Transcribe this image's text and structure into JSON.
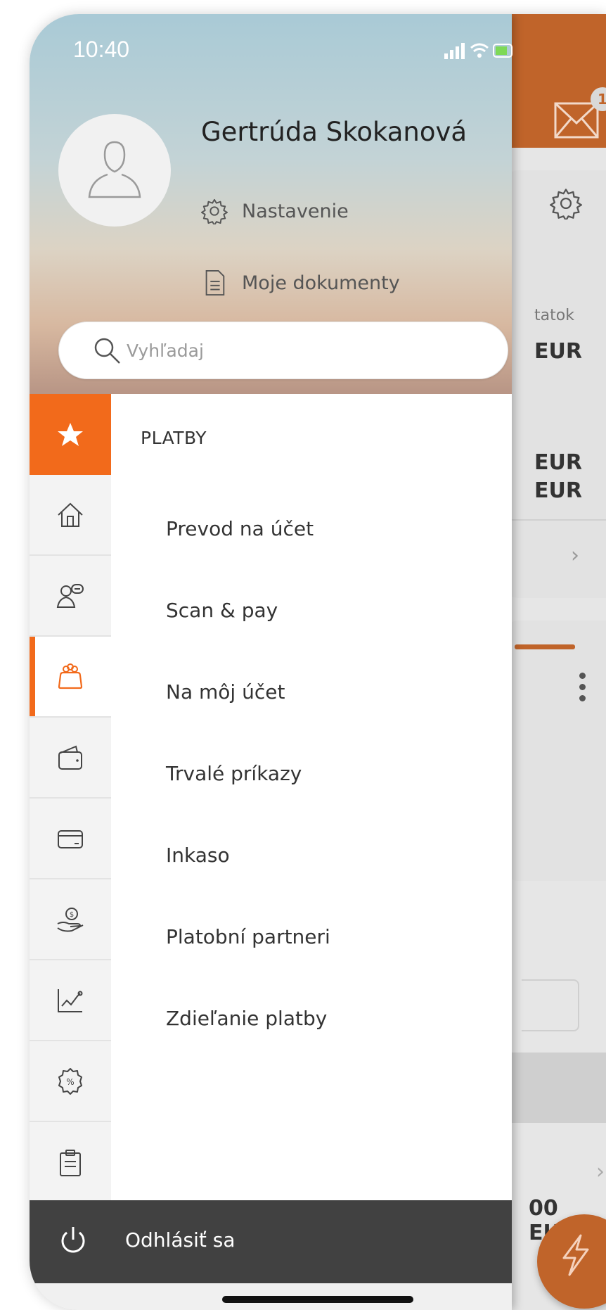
{
  "status_bar": {
    "time": "10:40"
  },
  "user": {
    "name": "Gertrúda Skokanová"
  },
  "header_links": {
    "settings": "Nastavenie",
    "documents": "Moje dokumenty"
  },
  "search": {
    "placeholder": "Vyhľadaj"
  },
  "rail": {
    "items": [
      {
        "icon": "star-icon",
        "state": "favorites"
      },
      {
        "icon": "home-icon"
      },
      {
        "icon": "user-chat-icon"
      },
      {
        "icon": "payments-purse-icon",
        "state": "active"
      },
      {
        "icon": "wallet-icon"
      },
      {
        "icon": "card-icon"
      },
      {
        "icon": "hand-coin-icon"
      },
      {
        "icon": "chart-line-icon"
      },
      {
        "icon": "percent-badge-icon"
      },
      {
        "icon": "clipboard-icon"
      }
    ]
  },
  "menu": {
    "section_title": "PLATBY",
    "items": [
      "Prevod na účet",
      "Scan & pay",
      "Na môj účet",
      "Trvalé príkazy",
      "Inkaso",
      "Platobní partneri",
      "Zdieľanie platby"
    ]
  },
  "logout": {
    "label": "Odhlásiť sa"
  },
  "background": {
    "mail_badge": "1",
    "text_tatok": "tatok",
    "eur_1": "EUR",
    "eur_2": "EUR",
    "eur_3": "EUR",
    "eur_4": "00 EUR"
  },
  "colors": {
    "accent": "#f26a1b",
    "header_brown": "#c0642a",
    "logout_bg": "#414141"
  }
}
